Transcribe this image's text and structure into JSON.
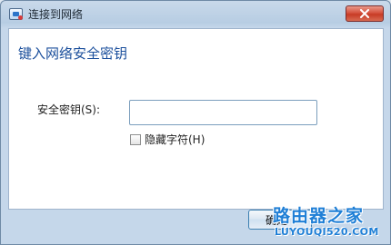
{
  "window": {
    "title": "连接到网络",
    "icon": "network-icon",
    "close_icon": "close-icon"
  },
  "main": {
    "heading": "键入网络安全密钥",
    "security_key_label": "安全密钥(S):",
    "security_key_value": "",
    "hide_characters_label": "隐藏字符(H)",
    "hide_characters_checked": false
  },
  "footer": {
    "ok_label": "确定"
  },
  "watermark": {
    "title": "路由器之家",
    "url": "LUYOUQI520.COM"
  },
  "colors": {
    "heading": "#1b4f9c",
    "close_button": "#c73b25",
    "watermark": "#1f7fd6"
  }
}
